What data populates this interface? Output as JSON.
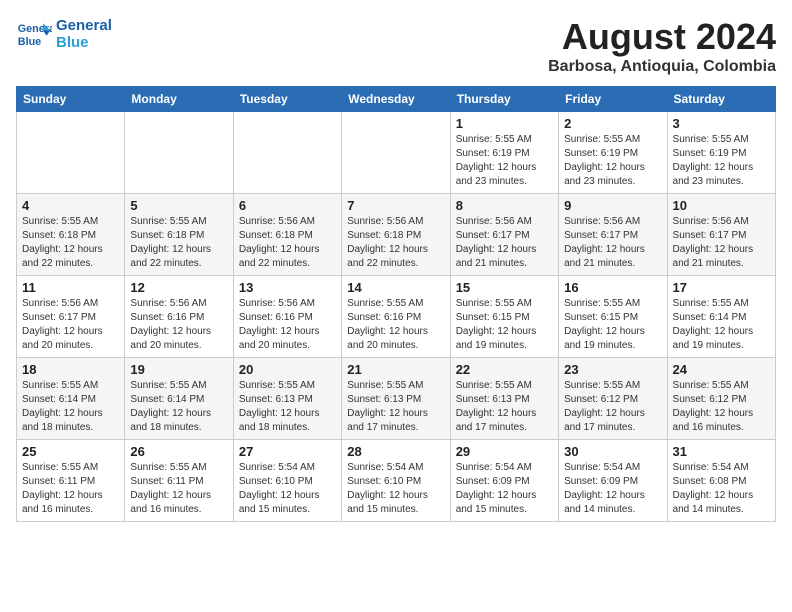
{
  "logo": {
    "line1": "General",
    "line2": "Blue"
  },
  "title": {
    "month_year": "August 2024",
    "location": "Barbosa, Antioquia, Colombia"
  },
  "weekdays": [
    "Sunday",
    "Monday",
    "Tuesday",
    "Wednesday",
    "Thursday",
    "Friday",
    "Saturday"
  ],
  "weeks": [
    [
      {
        "day": "",
        "sunrise": "",
        "sunset": "",
        "daylight": ""
      },
      {
        "day": "",
        "sunrise": "",
        "sunset": "",
        "daylight": ""
      },
      {
        "day": "",
        "sunrise": "",
        "sunset": "",
        "daylight": ""
      },
      {
        "day": "",
        "sunrise": "",
        "sunset": "",
        "daylight": ""
      },
      {
        "day": "1",
        "sunrise": "5:55 AM",
        "sunset": "6:19 PM",
        "daylight": "12 hours and 23 minutes."
      },
      {
        "day": "2",
        "sunrise": "5:55 AM",
        "sunset": "6:19 PM",
        "daylight": "12 hours and 23 minutes."
      },
      {
        "day": "3",
        "sunrise": "5:55 AM",
        "sunset": "6:19 PM",
        "daylight": "12 hours and 23 minutes."
      }
    ],
    [
      {
        "day": "4",
        "sunrise": "5:55 AM",
        "sunset": "6:18 PM",
        "daylight": "12 hours and 22 minutes."
      },
      {
        "day": "5",
        "sunrise": "5:55 AM",
        "sunset": "6:18 PM",
        "daylight": "12 hours and 22 minutes."
      },
      {
        "day": "6",
        "sunrise": "5:56 AM",
        "sunset": "6:18 PM",
        "daylight": "12 hours and 22 minutes."
      },
      {
        "day": "7",
        "sunrise": "5:56 AM",
        "sunset": "6:18 PM",
        "daylight": "12 hours and 22 minutes."
      },
      {
        "day": "8",
        "sunrise": "5:56 AM",
        "sunset": "6:17 PM",
        "daylight": "12 hours and 21 minutes."
      },
      {
        "day": "9",
        "sunrise": "5:56 AM",
        "sunset": "6:17 PM",
        "daylight": "12 hours and 21 minutes."
      },
      {
        "day": "10",
        "sunrise": "5:56 AM",
        "sunset": "6:17 PM",
        "daylight": "12 hours and 21 minutes."
      }
    ],
    [
      {
        "day": "11",
        "sunrise": "5:56 AM",
        "sunset": "6:17 PM",
        "daylight": "12 hours and 20 minutes."
      },
      {
        "day": "12",
        "sunrise": "5:56 AM",
        "sunset": "6:16 PM",
        "daylight": "12 hours and 20 minutes."
      },
      {
        "day": "13",
        "sunrise": "5:56 AM",
        "sunset": "6:16 PM",
        "daylight": "12 hours and 20 minutes."
      },
      {
        "day": "14",
        "sunrise": "5:55 AM",
        "sunset": "6:16 PM",
        "daylight": "12 hours and 20 minutes."
      },
      {
        "day": "15",
        "sunrise": "5:55 AM",
        "sunset": "6:15 PM",
        "daylight": "12 hours and 19 minutes."
      },
      {
        "day": "16",
        "sunrise": "5:55 AM",
        "sunset": "6:15 PM",
        "daylight": "12 hours and 19 minutes."
      },
      {
        "day": "17",
        "sunrise": "5:55 AM",
        "sunset": "6:14 PM",
        "daylight": "12 hours and 19 minutes."
      }
    ],
    [
      {
        "day": "18",
        "sunrise": "5:55 AM",
        "sunset": "6:14 PM",
        "daylight": "12 hours and 18 minutes."
      },
      {
        "day": "19",
        "sunrise": "5:55 AM",
        "sunset": "6:14 PM",
        "daylight": "12 hours and 18 minutes."
      },
      {
        "day": "20",
        "sunrise": "5:55 AM",
        "sunset": "6:13 PM",
        "daylight": "12 hours and 18 minutes."
      },
      {
        "day": "21",
        "sunrise": "5:55 AM",
        "sunset": "6:13 PM",
        "daylight": "12 hours and 17 minutes."
      },
      {
        "day": "22",
        "sunrise": "5:55 AM",
        "sunset": "6:13 PM",
        "daylight": "12 hours and 17 minutes."
      },
      {
        "day": "23",
        "sunrise": "5:55 AM",
        "sunset": "6:12 PM",
        "daylight": "12 hours and 17 minutes."
      },
      {
        "day": "24",
        "sunrise": "5:55 AM",
        "sunset": "6:12 PM",
        "daylight": "12 hours and 16 minutes."
      }
    ],
    [
      {
        "day": "25",
        "sunrise": "5:55 AM",
        "sunset": "6:11 PM",
        "daylight": "12 hours and 16 minutes."
      },
      {
        "day": "26",
        "sunrise": "5:55 AM",
        "sunset": "6:11 PM",
        "daylight": "12 hours and 16 minutes."
      },
      {
        "day": "27",
        "sunrise": "5:54 AM",
        "sunset": "6:10 PM",
        "daylight": "12 hours and 15 minutes."
      },
      {
        "day": "28",
        "sunrise": "5:54 AM",
        "sunset": "6:10 PM",
        "daylight": "12 hours and 15 minutes."
      },
      {
        "day": "29",
        "sunrise": "5:54 AM",
        "sunset": "6:09 PM",
        "daylight": "12 hours and 15 minutes."
      },
      {
        "day": "30",
        "sunrise": "5:54 AM",
        "sunset": "6:09 PM",
        "daylight": "12 hours and 14 minutes."
      },
      {
        "day": "31",
        "sunrise": "5:54 AM",
        "sunset": "6:08 PM",
        "daylight": "12 hours and 14 minutes."
      }
    ]
  ]
}
